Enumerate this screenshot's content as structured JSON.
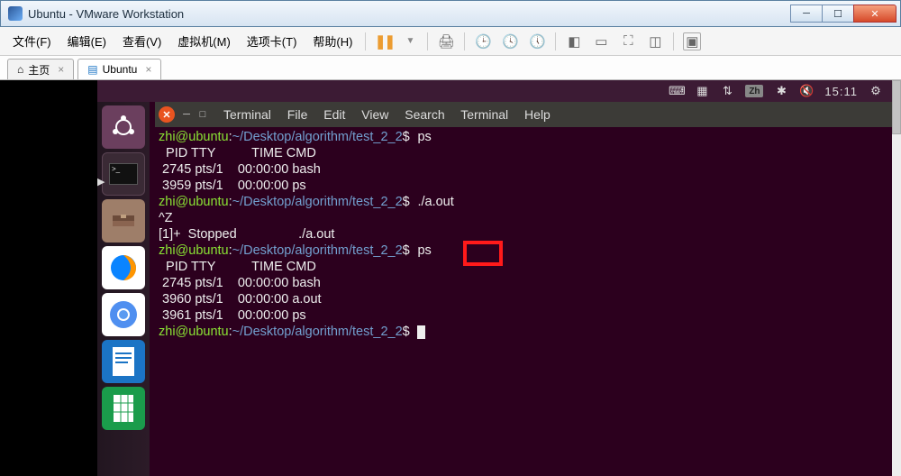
{
  "window": {
    "title": "Ubuntu - VMware Workstation"
  },
  "menubar": {
    "file": "文件(F)",
    "edit": "编辑(E)",
    "view": "查看(V)",
    "vm": "虚拟机(M)",
    "tabs": "选项卡(T)",
    "help": "帮助(H)"
  },
  "tabs": {
    "home": "主页",
    "ubuntu": "Ubuntu"
  },
  "ubuntu_panel": {
    "ime": "Zh",
    "time": "15:11"
  },
  "term_menu": {
    "terminal1": "Terminal",
    "file": "File",
    "edit": "Edit",
    "view": "View",
    "search": "Search",
    "terminal2": "Terminal",
    "help": "Help"
  },
  "prompt": {
    "user_host": "zhi@ubuntu",
    "sep": ":",
    "path": "~/Desktop/algorithm/test_2_2",
    "sym": "$"
  },
  "terminal_lines": {
    "cmd1": "ps",
    "hdr": "  PID TTY          TIME CMD",
    "p1": " 2745 pts/1    00:00:00 bash",
    "p2": " 3959 pts/1    00:00:00 ps",
    "cmd2": "./a.out",
    "ctrlz": "^Z",
    "stopped": "[1]+  Stopped                 ./a.out",
    "cmd3": "ps",
    "hdr2": "  PID TTY          TIME CMD",
    "p3": " 2745 pts/1    00:00:00 bash",
    "p4": " 3960 pts/1    00:00:00 a.out",
    "p5": " 3961 pts/1    00:00:00 ps"
  },
  "launcher": {
    "dash": "dash",
    "terminal": "terminal",
    "files": "files",
    "firefox": "firefox",
    "chromium": "chromium",
    "writer": "writer",
    "calc": "calc"
  }
}
